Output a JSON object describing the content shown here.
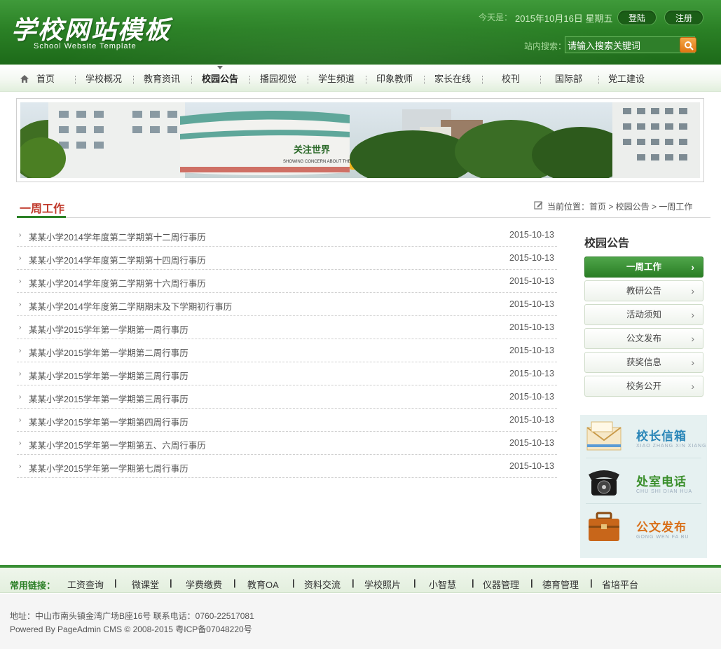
{
  "header": {
    "logo_title": "学校网站模板",
    "logo_subtitle": "School  Website Template",
    "date_label": "今天是：",
    "date_value": "2015年10月16日 星期五",
    "login_label": "登陆",
    "register_label": "注册",
    "search_label": "站内搜索：",
    "search_placeholder": "请输入搜索关键词",
    "search_icon": "search-icon"
  },
  "nav": {
    "items": [
      {
        "label": "首页",
        "icon": "home-icon"
      },
      {
        "label": "学校概况"
      },
      {
        "label": "教育资讯"
      },
      {
        "label": "校园公告",
        "active": true
      },
      {
        "label": "播园视觉"
      },
      {
        "label": "学生频道"
      },
      {
        "label": "印象教师"
      },
      {
        "label": "家长在线"
      },
      {
        "label": "校刊"
      },
      {
        "label": "国际部"
      },
      {
        "label": "党工建设"
      }
    ]
  },
  "banner": {
    "sign_text": "关注世界",
    "sign_sub": "SHOWING CONCERN ABOUT THE WORLD"
  },
  "content": {
    "section_title": "一周工作",
    "breadcrumb": "当前位置：首页 > 校园公告 > 一周工作",
    "news": [
      {
        "title": "某某小学2014学年度第二学期第十二周行事历",
        "date": "2015-10-13"
      },
      {
        "title": "某某小学2014学年度第二学期第十四周行事历",
        "date": "2015-10-13"
      },
      {
        "title": "某某小学2014学年度第二学期第十六周行事历",
        "date": "2015-10-13"
      },
      {
        "title": "某某小学2014学年度第二学期期末及下学期初行事历",
        "date": "2015-10-13"
      },
      {
        "title": "某某小学2015学年第一学期第一周行事历",
        "date": "2015-10-13"
      },
      {
        "title": "某某小学2015学年第一学期第二周行事历",
        "date": "2015-10-13"
      },
      {
        "title": "某某小学2015学年第一学期第三周行事历",
        "date": "2015-10-13"
      },
      {
        "title": "某某小学2015学年第一学期第三周行事历",
        "date": "2015-10-13"
      },
      {
        "title": "某某小学2015学年第一学期第四周行事历",
        "date": "2015-10-13"
      },
      {
        "title": "某某小学2015学年第一学期第五、六周行事历",
        "date": "2015-10-13"
      },
      {
        "title": "某某小学2015学年第一学期第七周行事历",
        "date": "2015-10-13"
      }
    ]
  },
  "sidebar": {
    "title": "校园公告",
    "items": [
      {
        "label": "一周工作",
        "active": true
      },
      {
        "label": "教研公告"
      },
      {
        "label": "活动须知"
      },
      {
        "label": "公文发布"
      },
      {
        "label": "获奖信息"
      },
      {
        "label": "校务公开"
      }
    ],
    "promos": [
      {
        "title": "校长信箱",
        "sub": "XIAO ZHANG XIN XIANG",
        "icon": "envelope-icon",
        "color": "#2a86b8"
      },
      {
        "title": "处室电话",
        "sub": "CHU SHI DIAN HUA",
        "icon": "telephone-icon",
        "color": "#3b8f2c"
      },
      {
        "title": "公文发布",
        "sub": "GONG WEN FA BU",
        "icon": "briefcase-icon",
        "color": "#d9701a"
      }
    ]
  },
  "footer": {
    "links_label": "常用链接：",
    "links": [
      "工资查询",
      "微课堂",
      "学费缴费",
      "教育OA",
      "资料交流",
      "学校照片",
      "小智慧",
      "仪器管理",
      "德育管理",
      "省培平台"
    ],
    "address": "地址：中山市南头镇金湾广场B座16号     联系电话：0760-22517081",
    "copyright": "Powered By PageAdmin CMS © 2008-2015     粤ICP备07048220号"
  },
  "colors": {
    "brand_green": "#2b8126",
    "title_red": "#c0392b"
  }
}
